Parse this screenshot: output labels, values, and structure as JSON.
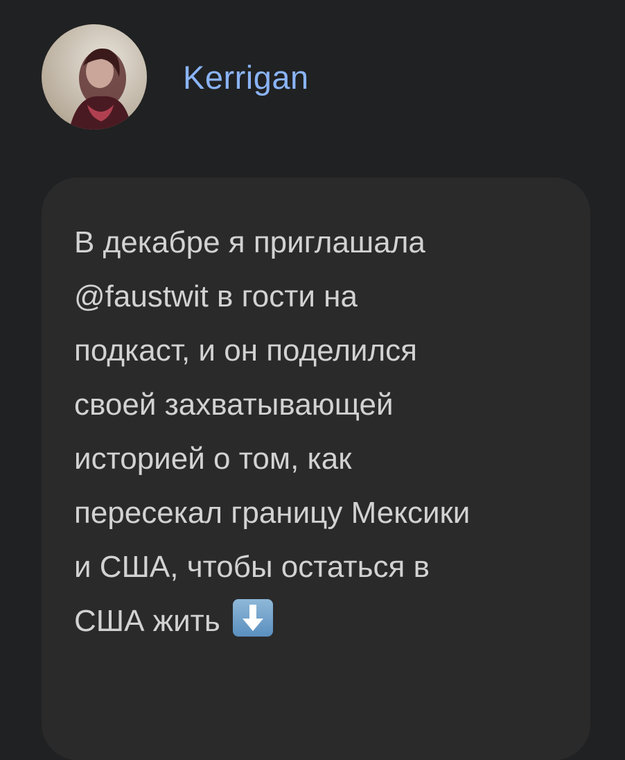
{
  "post": {
    "author": "Kerrigan",
    "text_lines": [
      "В декабре я приглашала",
      "@faustwit в гости на",
      "подкаст, и он поделился",
      "своей захватывающей",
      "историей о том, как",
      "пересекал границу Мексики",
      "и США, чтобы остаться в",
      "США жить"
    ],
    "emoji": "down-arrow-icon"
  },
  "colors": {
    "background": "#202122",
    "bubble": "#2a2a2b",
    "author": "#8ab4f8",
    "text": "#d2d2d2"
  }
}
